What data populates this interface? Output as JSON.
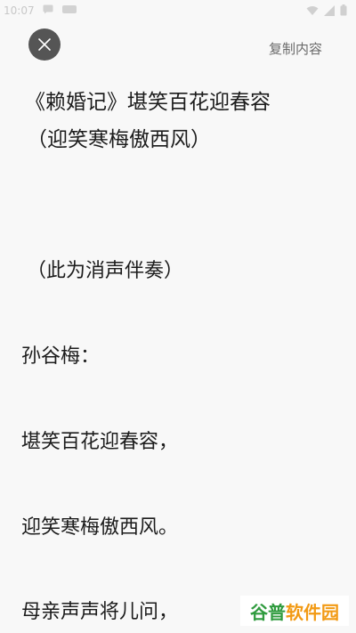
{
  "status_bar": {
    "time": "10:07",
    "left_icons": [
      "message-icon",
      "app-icon"
    ],
    "right_icons": [
      "wifi-icon",
      "signal-icon",
      "battery-icon"
    ]
  },
  "toolbar": {
    "close_icon": "close-icon",
    "copy_label": "复制内容"
  },
  "song": {
    "title_line1": "《赖婚记》堪笑百花迎春容",
    "title_line2": "（迎笑寒梅傲西风）",
    "lines": [
      "（此为消声伴奏）",
      "孙谷梅：",
      "堪笑百花迎春容，",
      "迎笑寒梅傲西风。",
      "母亲声声将儿问，"
    ]
  },
  "watermark": {
    "part1": "谷普",
    "part2": "软件园"
  },
  "colors": {
    "background": "#f8f8f8",
    "close_button": "#555555",
    "watermark_green": "#2f9b3e",
    "watermark_orange": "#f29a14"
  }
}
